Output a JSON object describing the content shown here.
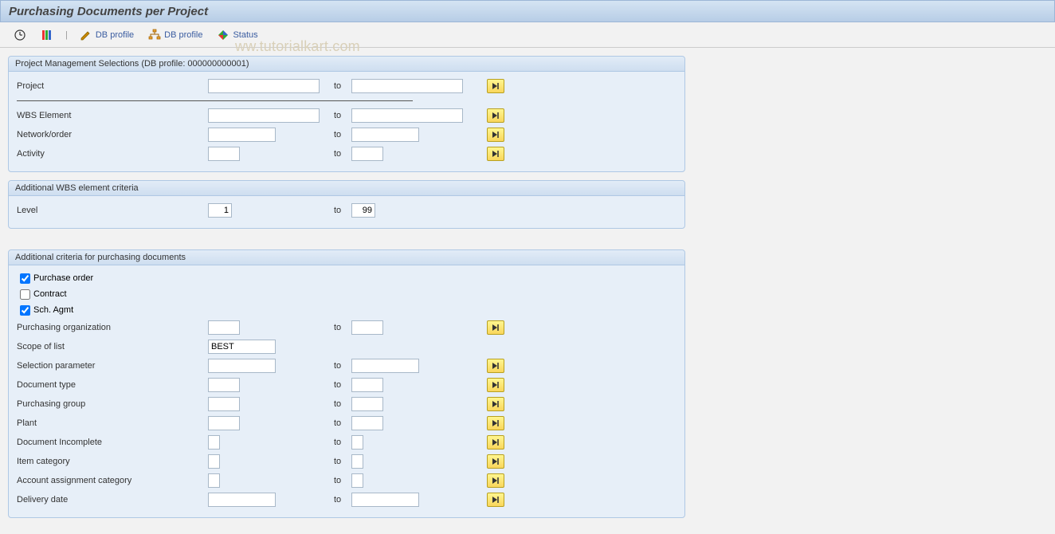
{
  "title": "Purchasing Documents per Project",
  "toolbar": {
    "db_profile_edit": "DB profile",
    "db_profile_view": "DB profile",
    "status": "Status"
  },
  "watermark": "ww.tutorialkart.com",
  "groups": {
    "pm": {
      "title": "Project Management Selections (DB profile: 000000000001)",
      "labels": {
        "project": "Project",
        "wbs": "WBS Element",
        "network": "Network/order",
        "activity": "Activity"
      }
    },
    "wbs_add": {
      "title": "Additional WBS element criteria",
      "labels": {
        "level": "Level"
      },
      "values": {
        "level_from": "1",
        "level_to": "99"
      }
    },
    "pur": {
      "title": "Additional criteria for purchasing documents",
      "labels": {
        "po": "Purchase order",
        "contract": "Contract",
        "sch": "Sch. Agmt",
        "porg": "Purchasing organization",
        "scope": "Scope of list",
        "selparam": "Selection parameter",
        "doctype": "Document type",
        "pgroup": "Purchasing group",
        "plant": "Plant",
        "docinc": "Document Incomplete",
        "itemcat": "Item category",
        "acctcat": "Account assignment category",
        "deldate": "Delivery date"
      },
      "values": {
        "scope": "BEST",
        "po_chk": true,
        "contract_chk": false,
        "sch_chk": true
      }
    }
  },
  "to_label": "to"
}
